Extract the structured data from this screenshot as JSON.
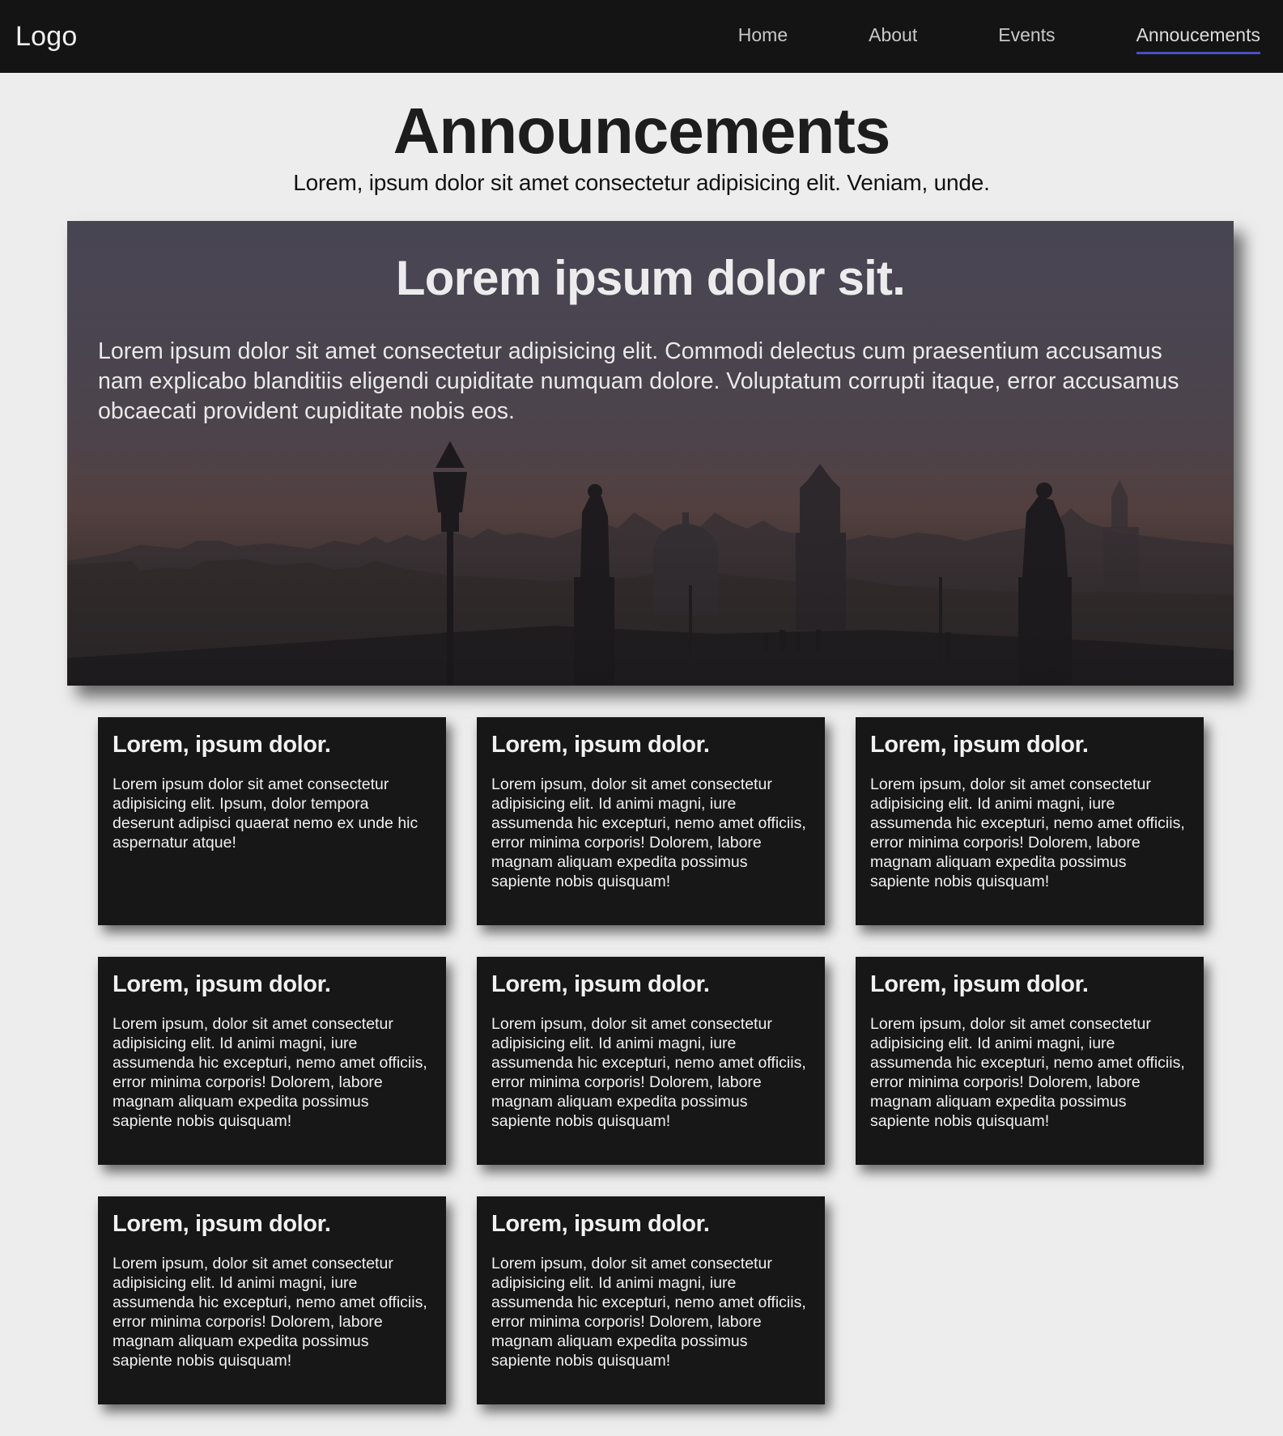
{
  "nav": {
    "logo": "Logo",
    "links": [
      {
        "label": "Home",
        "active": false
      },
      {
        "label": "About",
        "active": false
      },
      {
        "label": "Events",
        "active": false
      },
      {
        "label": "Annoucements",
        "active": true
      }
    ],
    "active_underline_color": "#4a4fc4"
  },
  "header": {
    "title": "Announcements",
    "subtitle": "Lorem, ipsum dolor sit amet consectetur adipisicing elit. Veniam, unde."
  },
  "hero": {
    "title": "Lorem ipsum dolor sit.",
    "text": "Lorem ipsum dolor sit amet consectetur adipisicing elit. Commodi delectus cum praesentium accusamus nam explicabo blanditiis eligendi cupiditate numquam dolore. Voluptatum corrupti itaque, error accusamus obcaecati provident cupiditate nobis eos."
  },
  "cards": [
    {
      "title": "Lorem, ipsum dolor.",
      "text": "Lorem ipsum dolor sit amet consectetur adipisicing elit. Ipsum, dolor tempora deserunt adipisci quaerat nemo ex unde hic aspernatur atque!"
    },
    {
      "title": "Lorem, ipsum dolor.",
      "text": "Lorem ipsum, dolor sit amet consectetur adipisicing elit. Id animi magni, iure assumenda hic excepturi, nemo amet officiis, error minima corporis! Dolorem, labore magnam aliquam expedita possimus sapiente nobis quisquam!"
    },
    {
      "title": "Lorem, ipsum dolor.",
      "text": "Lorem ipsum, dolor sit amet consectetur adipisicing elit. Id animi magni, iure assumenda hic excepturi, nemo amet officiis, error minima corporis! Dolorem, labore magnam aliquam expedita possimus sapiente nobis quisquam!"
    },
    {
      "title": "Lorem, ipsum dolor.",
      "text": "Lorem ipsum, dolor sit amet consectetur adipisicing elit. Id animi magni, iure assumenda hic excepturi, nemo amet officiis, error minima corporis! Dolorem, labore magnam aliquam expedita possimus sapiente nobis quisquam!"
    },
    {
      "title": "Lorem, ipsum dolor.",
      "text": "Lorem ipsum, dolor sit amet consectetur adipisicing elit. Id animi magni, iure assumenda hic excepturi, nemo amet officiis, error minima corporis! Dolorem, labore magnam aliquam expedita possimus sapiente nobis quisquam!"
    },
    {
      "title": "Lorem, ipsum dolor.",
      "text": "Lorem ipsum, dolor sit amet consectetur adipisicing elit. Id animi magni, iure assumenda hic excepturi, nemo amet officiis, error minima corporis! Dolorem, labore magnam aliquam expedita possimus sapiente nobis quisquam!"
    },
    {
      "title": "Lorem, ipsum dolor.",
      "text": "Lorem ipsum, dolor sit amet consectetur adipisicing elit. Id animi magni, iure assumenda hic excepturi, nemo amet officiis, error minima corporis! Dolorem, labore magnam aliquam expedita possimus sapiente nobis quisquam!"
    },
    {
      "title": "Lorem, ipsum dolor.",
      "text": "Lorem ipsum, dolor sit amet consectetur adipisicing elit. Id animi magni, iure assumenda hic excepturi, nemo amet officiis, error minima corporis! Dolorem, labore magnam aliquam expedita possimus sapiente nobis quisquam!"
    }
  ]
}
